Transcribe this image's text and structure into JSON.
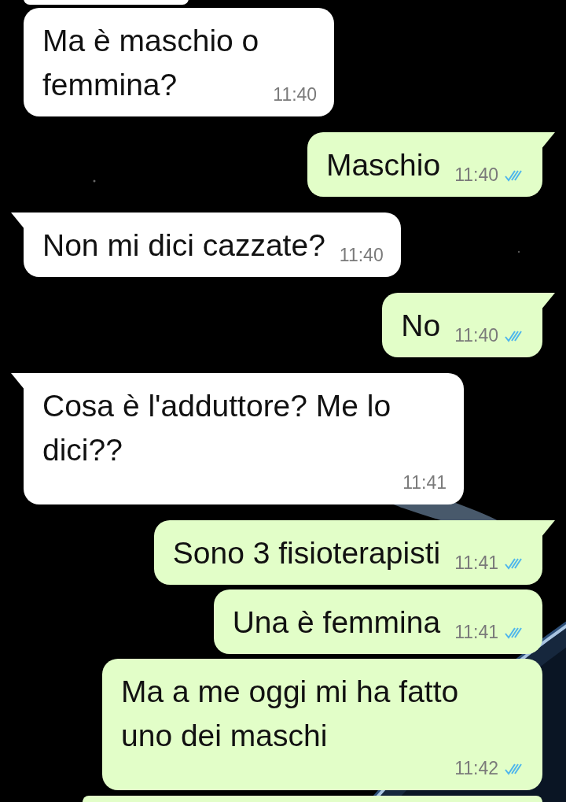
{
  "messages": [
    {
      "kind": "incoming",
      "tail": false,
      "text": "Ma è maschio o\nfemmina?",
      "time": "11:40"
    },
    {
      "kind": "outgoing",
      "tail": true,
      "text": "Maschio",
      "time": "11:40",
      "read": true
    },
    {
      "kind": "incoming",
      "tail": true,
      "text": "Non mi dici cazzate?",
      "time": "11:40"
    },
    {
      "kind": "outgoing",
      "tail": true,
      "text": "No",
      "time": "11:40",
      "read": true
    },
    {
      "kind": "incoming",
      "tail": true,
      "text": "Cosa è l'adduttore? Me lo\ndici??",
      "time": "11:41"
    },
    {
      "kind": "outgoing",
      "tail": true,
      "text": "Sono 3 fisioterapisti",
      "time": "11:41",
      "read": true
    },
    {
      "kind": "outgoing",
      "tail": false,
      "text": "Una è femmina",
      "time": "11:41",
      "read": true
    },
    {
      "kind": "outgoing",
      "tail": false,
      "text": "Ma a me oggi mi ha fatto\nuno dei maschi",
      "time": "11:42",
      "read": true
    }
  ]
}
